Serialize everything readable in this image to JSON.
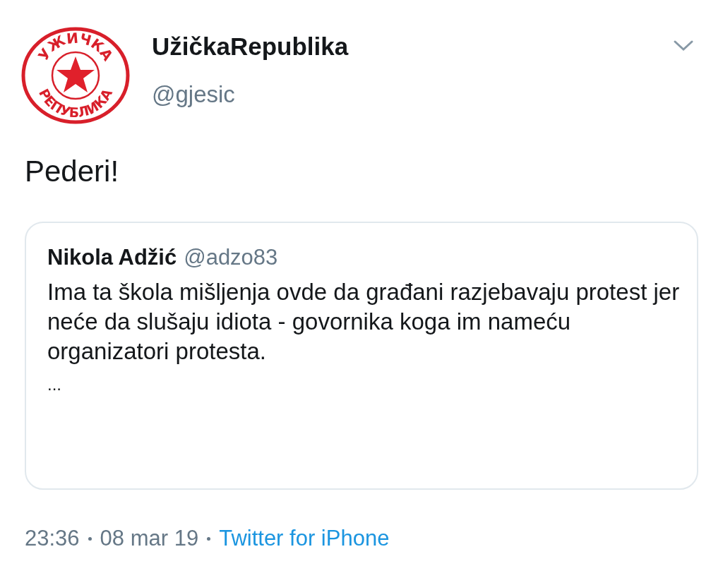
{
  "author": {
    "avatar": {
      "top_text": "УЖИЧКА",
      "bottom_text": "РЕПУБЛИКА"
    },
    "name": "UžičkaRepublika",
    "handle": "@gjesic"
  },
  "text": "Pederi!",
  "quoted_tweet": {
    "name": "Nikola Adžić",
    "handle": "@adzo83",
    "text": "Ima ta škola mišljenja ovde da građani razjebavaju protest jer neće da slušaju idiota - govornika koga im nameću organizatori protesta.",
    "more": "..."
  },
  "footer": {
    "time": "23:36",
    "date": "08 mar 19",
    "source": "Twitter for iPhone"
  }
}
